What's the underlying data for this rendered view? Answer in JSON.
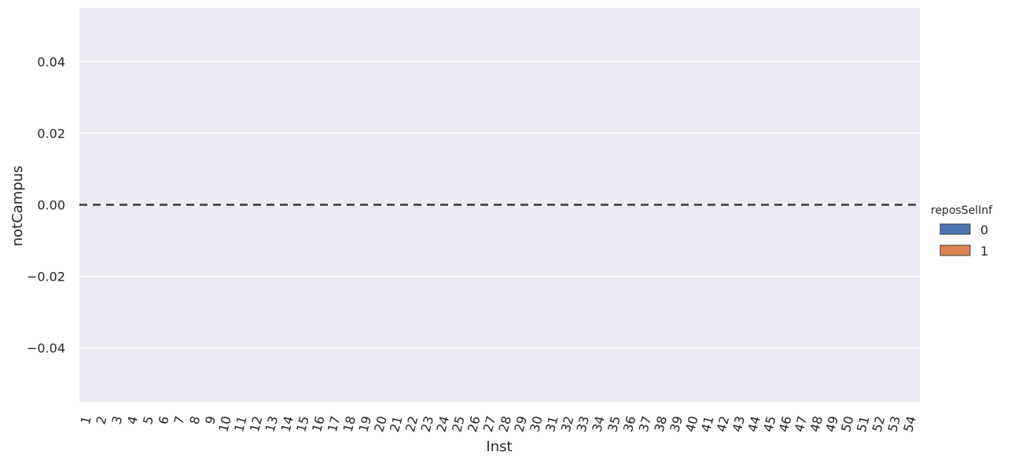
{
  "chart_data": {
    "type": "bar",
    "xlabel": "Inst",
    "ylabel": "notCampus",
    "categories": [
      "1",
      "2",
      "3",
      "4",
      "5",
      "6",
      "7",
      "8",
      "9",
      "10",
      "11",
      "12",
      "13",
      "14",
      "15",
      "16",
      "17",
      "18",
      "19",
      "20",
      "21",
      "22",
      "23",
      "24",
      "25",
      "26",
      "27",
      "28",
      "29",
      "30",
      "31",
      "32",
      "33",
      "34",
      "35",
      "36",
      "37",
      "38",
      "39",
      "40",
      "41",
      "42",
      "43",
      "44",
      "45",
      "46",
      "47",
      "48",
      "49",
      "50",
      "51",
      "52",
      "53",
      "54"
    ],
    "series": [
      {
        "name": "0",
        "color": "#4c72b0",
        "values": [
          0,
          0,
          0,
          0,
          0,
          0,
          0,
          0,
          0,
          0,
          0,
          0,
          0,
          0,
          0,
          0,
          0,
          0,
          0,
          0,
          0,
          0,
          0,
          0,
          0,
          0,
          0,
          0,
          0,
          0,
          0,
          0,
          0,
          0,
          0,
          0,
          0,
          0,
          0,
          0,
          0,
          0,
          0,
          0,
          0,
          0,
          0,
          0,
          0,
          0,
          0,
          0,
          0,
          0
        ]
      },
      {
        "name": "1",
        "color": "#dd8452",
        "values": [
          0,
          0,
          0,
          0,
          0,
          0,
          0,
          0,
          0,
          0,
          0,
          0,
          0,
          0,
          0,
          0,
          0,
          0,
          0,
          0,
          0,
          0,
          0,
          0,
          0,
          0,
          0,
          0,
          0,
          0,
          0,
          0,
          0,
          0,
          0,
          0,
          0,
          0,
          0,
          0,
          0,
          0,
          0,
          0,
          0,
          0,
          0,
          0,
          0,
          0,
          0,
          0,
          0,
          0
        ]
      }
    ],
    "ylim": [
      -0.055,
      0.055
    ],
    "yticks": [
      -0.04,
      -0.02,
      0.0,
      0.02,
      0.04
    ],
    "ytick_labels": [
      "−0.04",
      "−0.02",
      "0.00",
      "0.02",
      "0.04"
    ],
    "reference_line": {
      "y": 0,
      "style": "dashed",
      "color": "#3a3a3a"
    },
    "legend": {
      "title": "reposSelInf",
      "placement": "right",
      "entries": [
        "0",
        "1"
      ]
    },
    "grid": true,
    "background": "#eaeaf2",
    "xtick_rotation_deg": -75
  }
}
